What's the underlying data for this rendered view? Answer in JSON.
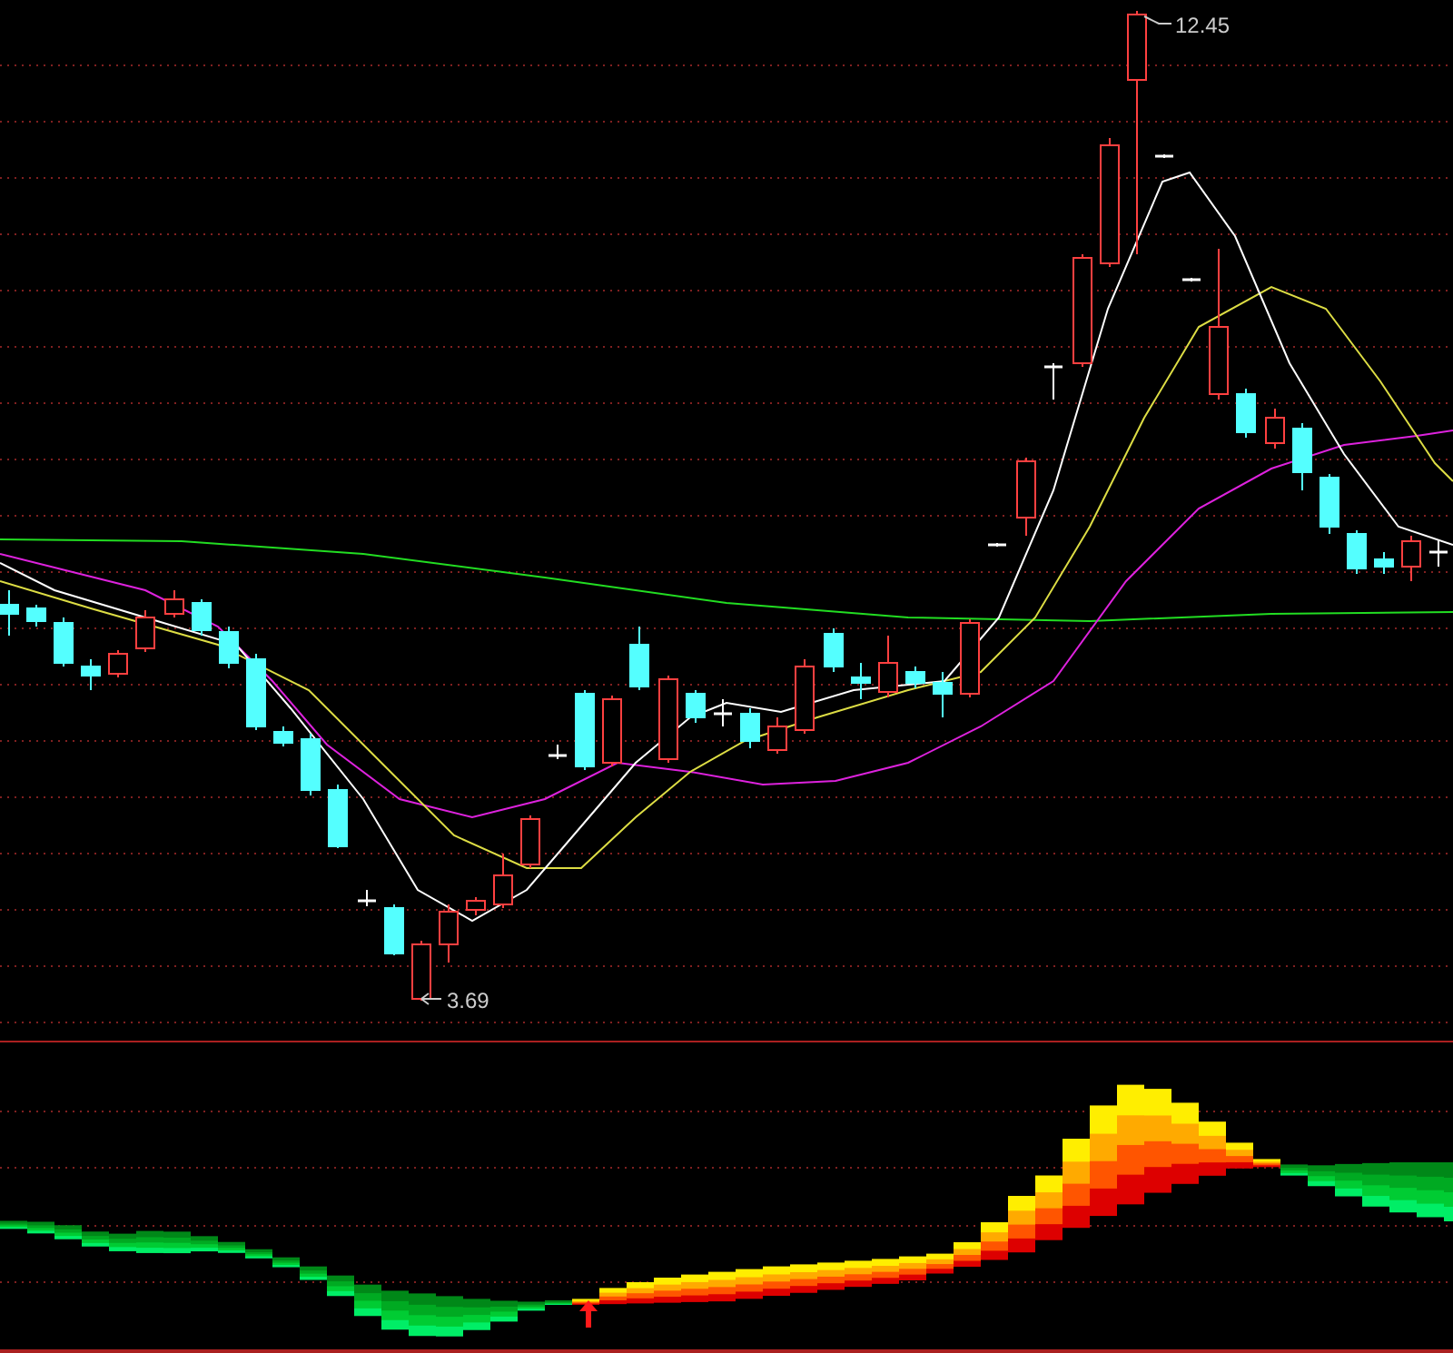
{
  "price_chart": {
    "high_label": "12.45",
    "low_label": "3.69"
  }
}
